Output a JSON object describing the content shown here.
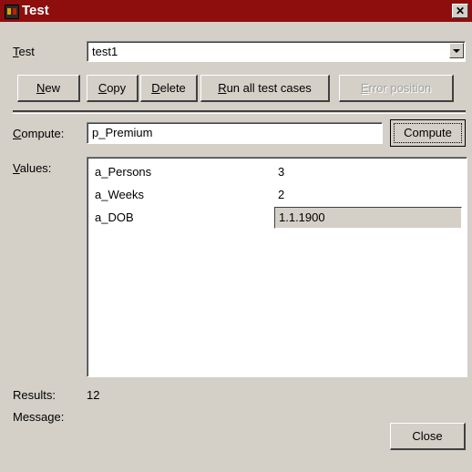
{
  "window": {
    "title": "Test",
    "close_glyph": "✕"
  },
  "test_field": {
    "label": "Test",
    "value": "test1"
  },
  "buttons": {
    "new": "New",
    "copy": "Copy",
    "delete": "Delete",
    "run_all": "Run all test cases",
    "error_position": "Error position",
    "compute": "Compute",
    "close": "Close"
  },
  "compute_field": {
    "label": "Compute:",
    "value": "p_Premium"
  },
  "values": {
    "label": "Values:",
    "rows": [
      {
        "name": "a_Persons",
        "value": "3"
      },
      {
        "name": "a_Weeks",
        "value": "2"
      },
      {
        "name": "a_DOB",
        "value": "1.1.1900"
      }
    ]
  },
  "results": {
    "label": "Results:",
    "value": "12"
  },
  "message": {
    "label": "Message:",
    "value": ""
  }
}
